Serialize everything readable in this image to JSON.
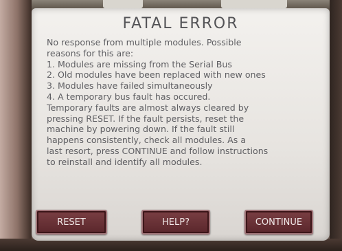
{
  "dialog": {
    "title": "FATAL ERROR",
    "lines": [
      "No response from multiple modules.  Possible",
      "reasons for this are:",
      "1.  Modules are missing from the Serial Bus",
      "2.  Old modules have been replaced with new ones",
      "3.  Modules have failed simultaneously",
      "4.  A temporary bus fault has occured.",
      "Temporary faults are almost always cleared by",
      "pressing RESET.  If the fault persists, reset the",
      "machine by powering down.  If the fault still",
      "happens consistently, check all modules.  As a",
      "last resort, press CONTINUE and follow instructions",
      "to reinstall and identify all modules."
    ]
  },
  "buttons": {
    "reset": "RESET",
    "help": "HELP?",
    "continue": "CONTINUE"
  },
  "colors": {
    "screen_background": "#eeece9",
    "text": "#5e5e62",
    "button_fill": "#6a3236",
    "button_text": "#f1e8e8",
    "bezel": "#6b5a52"
  }
}
